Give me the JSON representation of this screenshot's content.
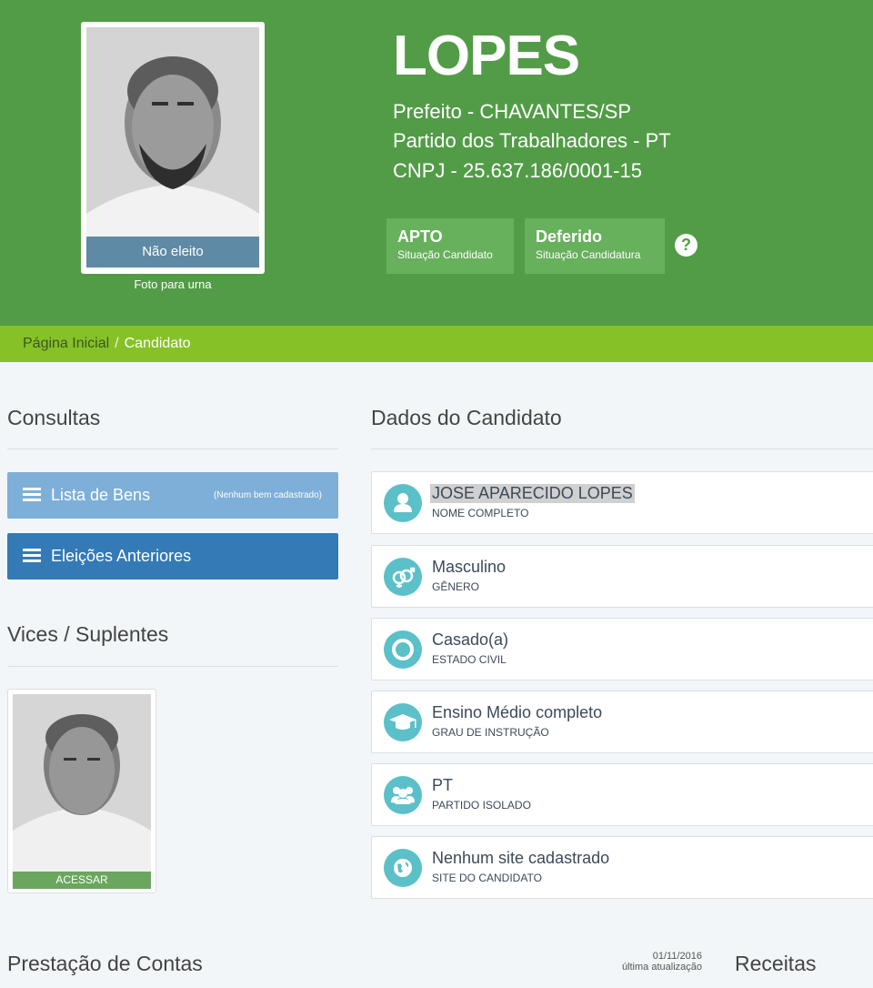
{
  "candidate": {
    "name": "LOPES",
    "office_line": "Prefeito - CHAVANTES/SP",
    "party_line": "Partido dos Trabalhadores - PT",
    "cnpj_line": "CNPJ - 25.637.186/0001-15",
    "photo_status": "Não eleito",
    "photo_caption": "Foto para urna"
  },
  "badges": [
    {
      "value": "APTO",
      "label": "Situação Candidato"
    },
    {
      "value": "Deferido",
      "label": "Situação Candidatura"
    }
  ],
  "help": "?",
  "breadcrumb": {
    "home": "Página Inicial",
    "separator": "/",
    "current": "Candidato"
  },
  "left": {
    "consultas_title": "Consultas",
    "bens_label": "Lista de Bens",
    "bens_note": "(Nenhum bem cadastrado)",
    "eleicoes_label": "Eleições Anteriores",
    "vices_title": "Vices / Suplentes",
    "vice_button": "ACESSAR"
  },
  "dados": {
    "title": "Dados do Candidato",
    "items": [
      {
        "value": "JOSE APARECIDO LOPES",
        "label": "NOME COMPLETO",
        "icon": "user-icon"
      },
      {
        "value": "Masculino",
        "label": "GÊNERO",
        "icon": "gender-icon"
      },
      {
        "value": "Casado(a)",
        "label": "ESTADO CIVIL",
        "icon": "ring-icon"
      },
      {
        "value": "Ensino Médio completo",
        "label": "GRAU DE INSTRUÇÃO",
        "icon": "graduation-cap-icon"
      },
      {
        "value": "PT",
        "label": "PARTIDO ISOLADO",
        "icon": "group-icon"
      },
      {
        "value": "Nenhum site cadastrado",
        "label": "SITE DO CANDIDATO",
        "icon": "globe-icon"
      }
    ]
  },
  "bottom": {
    "prestacao_title": "Prestação de Contas",
    "update_date": "01/11/2016",
    "update_label": "última atualização",
    "receitas_title": "Receitas"
  },
  "colors": {
    "header": "#529c47",
    "breadcrumb": "#86c127",
    "icon_circle": "#5bc0c8",
    "primary_button": "#337ab7"
  }
}
